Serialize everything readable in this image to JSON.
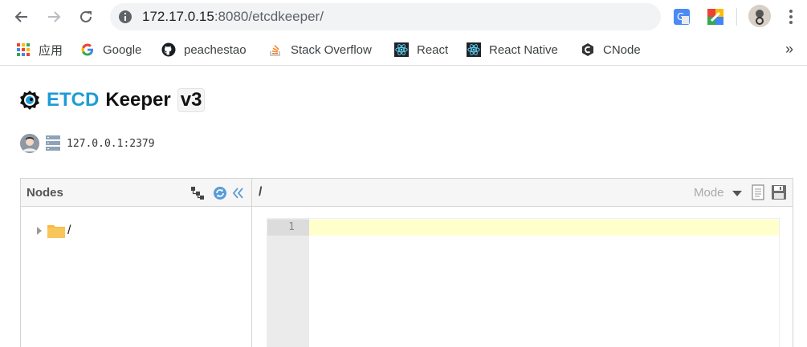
{
  "browser": {
    "url_host": "172.17.0.15",
    "url_rest": ":8080/etcdkeeper/",
    "bookmarks": [
      {
        "label": "应用",
        "icon": "apps-grid-icon"
      },
      {
        "label": "Google",
        "icon": "google-icon"
      },
      {
        "label": "peachestao",
        "icon": "github-icon"
      },
      {
        "label": "Stack Overflow",
        "icon": "stackoverflow-icon"
      },
      {
        "label": "React",
        "icon": "react-icon"
      },
      {
        "label": "React Native",
        "icon": "react-icon"
      },
      {
        "label": "CNode",
        "icon": "cnode-icon"
      }
    ],
    "more_label": "»"
  },
  "app": {
    "title_etcd": "ETCD",
    "title_keeper": "Keeper",
    "version": "v3",
    "host": "127.0.0.1:2379"
  },
  "nodes_panel": {
    "title": "Nodes",
    "tree": [
      {
        "label": "/"
      }
    ]
  },
  "editor_panel": {
    "path": "/",
    "mode_label": "Mode",
    "line_numbers": [
      "1"
    ]
  },
  "colors": {
    "accent": "#1e9bd7",
    "active_line": "#ffffcc",
    "folder": "#f5b942"
  }
}
